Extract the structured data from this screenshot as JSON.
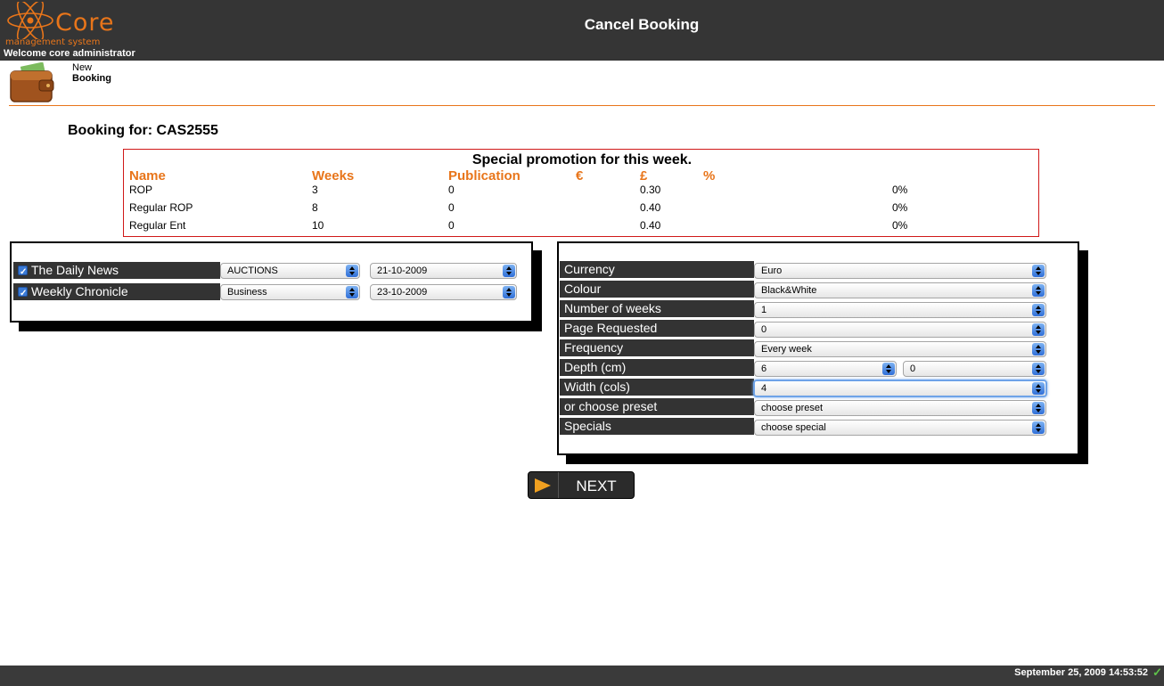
{
  "header": {
    "logo_word": "Core",
    "logo_sub": "management system",
    "welcome": "Welcome core administrator",
    "page_title": "Cancel Booking"
  },
  "new_booking": {
    "line1": "New",
    "line2": "Booking"
  },
  "booking_for": "Booking for: CAS2555",
  "promo": {
    "title": "Special promotion for this week.",
    "headers": [
      "Name",
      "Weeks",
      "Publication",
      "€",
      "£",
      "%"
    ],
    "rows": [
      {
        "name": "ROP",
        "weeks": "3",
        "publication": "0",
        "pound": "0.30",
        "percent": "0%"
      },
      {
        "name": "Regular ROP",
        "weeks": "8",
        "publication": "0",
        "pound": "0.40",
        "percent": "0%"
      },
      {
        "name": "Regular Ent",
        "weeks": "10",
        "publication": "0",
        "pound": "0.40",
        "percent": "0%"
      }
    ]
  },
  "publications": [
    {
      "name": "The Daily News",
      "checked": true,
      "section": "AUCTIONS",
      "date": "21-10-2009"
    },
    {
      "name": "Weekly Chronicle",
      "checked": true,
      "section": "Business",
      "date": "23-10-2009"
    }
  ],
  "options": {
    "currency": {
      "label": "Currency",
      "value": "Euro"
    },
    "colour": {
      "label": "Colour",
      "value": "Black&White"
    },
    "weeks": {
      "label": "Number of weeks",
      "value": "1"
    },
    "page": {
      "label": "Page Requested",
      "value": "0"
    },
    "frequency": {
      "label": "Frequency",
      "value": "Every week"
    },
    "depth": {
      "label": "Depth (cm)",
      "value": "6",
      "value2": "0"
    },
    "width": {
      "label": "Width (cols)",
      "value": "4"
    },
    "preset": {
      "label": "or choose preset",
      "value": "choose preset"
    },
    "specials": {
      "label": "Specials",
      "value": "choose special"
    }
  },
  "next_label": "NEXT",
  "footer": {
    "datetime": "September 25, 2009 14:53:52"
  },
  "colors": {
    "accent": "#e8751a",
    "bar": "#353535",
    "promo_border": "#d01818"
  }
}
